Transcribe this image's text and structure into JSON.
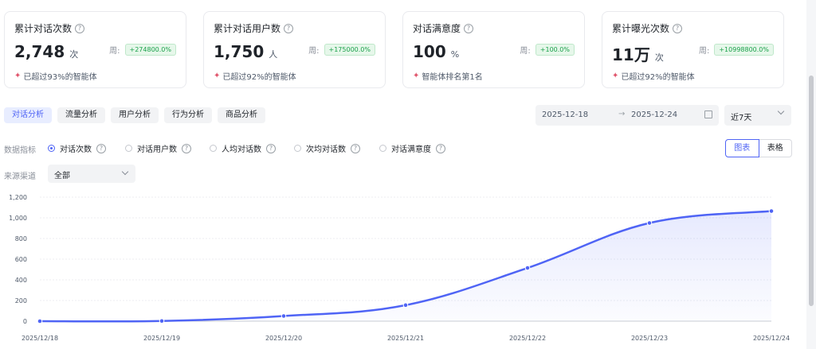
{
  "stats": [
    {
      "title": "累计对话次数",
      "value": "2,748",
      "unit": "次",
      "week_label": "周:",
      "change": "+274800.0%",
      "note": "已超过93%的智能体"
    },
    {
      "title": "累计对话用户数",
      "value": "1,750",
      "unit": "人",
      "week_label": "周:",
      "change": "+175000.0%",
      "note": "已超过92%的智能体"
    },
    {
      "title": "对话满意度",
      "value": "100",
      "unit": "%",
      "week_label": "周:",
      "change": "+100.0%",
      "note": "智能体排名第1名"
    },
    {
      "title": "累计曝光次数",
      "value": "11万",
      "unit": "次",
      "week_label": "周:",
      "change": "+10998800.0%",
      "note": "已超过92%的智能体"
    }
  ],
  "tabs": [
    "对话分析",
    "流量分析",
    "用户分析",
    "行为分析",
    "商品分析"
  ],
  "date_range": {
    "start": "2025-12-18",
    "arrow": "→",
    "end": "2025-12-24"
  },
  "period": "近7天",
  "metric_label": "数据指标",
  "metrics": [
    "对话次数",
    "对话用户数",
    "人均对话数",
    "次均对话数",
    "对话满意度"
  ],
  "selected_metric": "对话次数",
  "view_toggle": {
    "chart": "图表",
    "table": "表格"
  },
  "source_label": "来源渠道",
  "source_value": "全部",
  "icons": {
    "help": "question-circle-icon",
    "note": "party-popper-icon",
    "calendar": "calendar-icon",
    "dropdown": "chevron-down-icon"
  },
  "colors": {
    "accent": "#4f64f5",
    "positive": "#1aa14a"
  },
  "chart_data": {
    "type": "line",
    "categories": [
      "2025/12/18",
      "2025/12/19",
      "2025/12/20",
      "2025/12/21",
      "2025/12/22",
      "2025/12/23",
      "2025/12/24"
    ],
    "values": [
      0,
      2,
      50,
      155,
      515,
      950,
      1065
    ],
    "yticks": [
      0,
      200,
      400,
      600,
      800,
      1000,
      1200
    ],
    "ylim": [
      0,
      1200
    ],
    "grid": true,
    "area_fill": true
  }
}
